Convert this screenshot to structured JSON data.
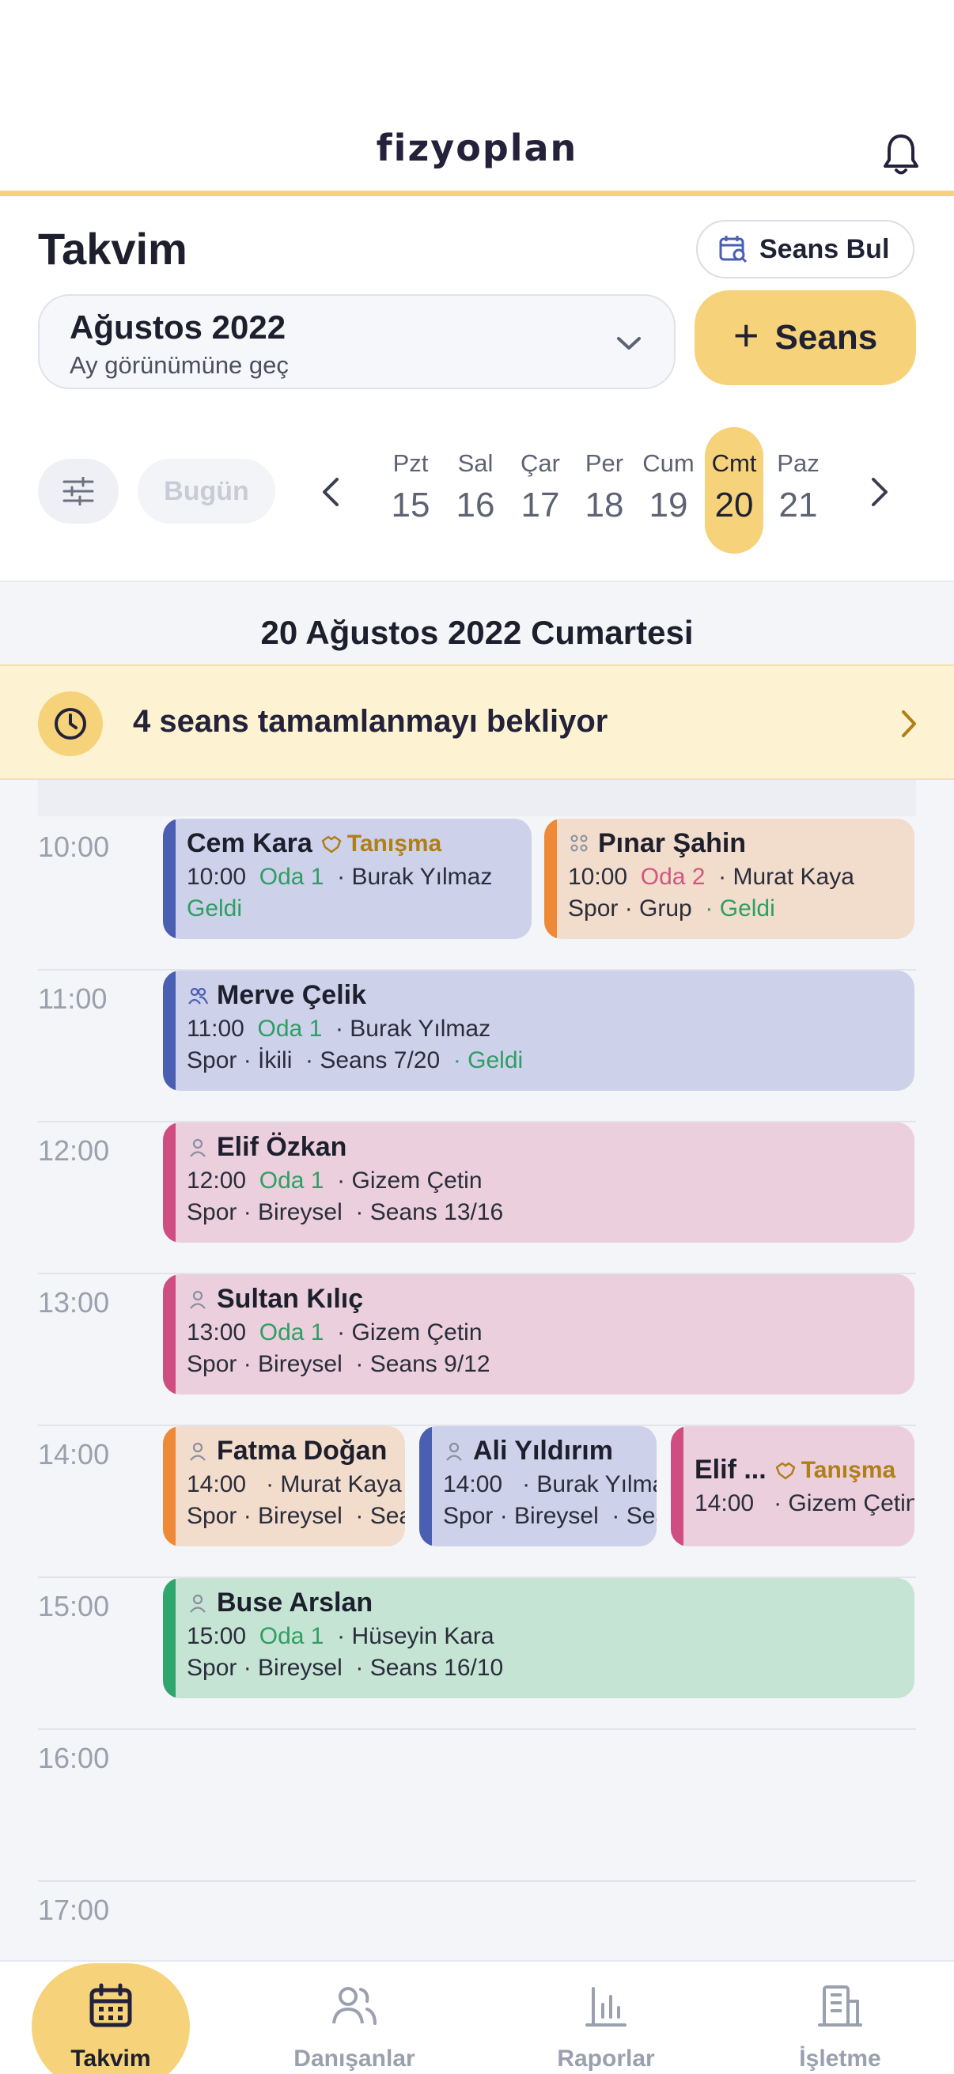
{
  "app": {
    "logo": "fizyoplan"
  },
  "header": {
    "title": "Takvim",
    "find_session_label": "Seans Bul",
    "month": "Ağustos 2022",
    "month_subtitle": "Ay görünümüne geç",
    "add_session_label": "Seans"
  },
  "week": {
    "today_label": "Bugün",
    "days": [
      {
        "name": "Pzt",
        "num": "15"
      },
      {
        "name": "Sal",
        "num": "16"
      },
      {
        "name": "Çar",
        "num": "17"
      },
      {
        "name": "Per",
        "num": "18"
      },
      {
        "name": "Cum",
        "num": "19"
      },
      {
        "name": "Cmt",
        "num": "20",
        "selected": true
      },
      {
        "name": "Paz",
        "num": "21"
      }
    ]
  },
  "day": {
    "heading": "20 Ağustos 2022 Cumartesi",
    "pending_text": "4 seans tamamlanmayı bekliyor",
    "hours": [
      "10:00",
      "11:00",
      "12:00",
      "13:00",
      "14:00",
      "15:00",
      "16:00",
      "17:00"
    ]
  },
  "events": {
    "e1": {
      "name": "Cem Kara",
      "tag": "Tanışma",
      "time": "10:00",
      "room": "Oda 1",
      "therapist": "· Burak Yılmaz",
      "status": "Geldi"
    },
    "e2": {
      "name": "Pınar Şahin",
      "time": "10:00",
      "room": "Oda 2",
      "therapist": "· Murat Kaya",
      "detail": "Spor · Grup",
      "status": "· Geldi"
    },
    "e3": {
      "name": "Merve Çelik",
      "time": "11:00",
      "room": "Oda 1",
      "therapist": "· Burak Yılmaz",
      "detail": "Spor · İkili",
      "sessions": "· Seans 7/20",
      "status": "· Geldi"
    },
    "e4": {
      "name": "Elif Özkan",
      "time": "12:00",
      "room": "Oda 1",
      "therapist": "· Gizem Çetin",
      "detail": "Spor · Bireysel",
      "sessions": "· Seans 13/16"
    },
    "e5": {
      "name": "Sultan Kılıç",
      "time": "13:00",
      "room": "Oda 1",
      "therapist": "· Gizem Çetin",
      "detail": "Spor · Bireysel",
      "sessions": "· Seans 9/12"
    },
    "e6": {
      "name": "Fatma Doğan",
      "time": "14:00",
      "therapist": "· Murat Kaya",
      "detail": "Spor · Bireysel",
      "sessions": "· Seans"
    },
    "e7": {
      "name": "Ali Yıldırım",
      "time": "14:00",
      "therapist": "· Burak Yılmaz",
      "detail": "Spor · Bireysel",
      "sessions": "· Seans"
    },
    "e8": {
      "name": "Elif ...",
      "tag": "Tanışma",
      "time": "14:00",
      "therapist": "· Gizem Çetin"
    },
    "e9": {
      "name": "Buse Arslan",
      "time": "15:00",
      "room": "Oda 1",
      "therapist": "· Hüseyin Kara",
      "detail": "Spor · Bireysel",
      "sessions": "· Seans 16/10"
    }
  },
  "nav": {
    "calendar": "Takvim",
    "clients": "Danışanlar",
    "reports": "Raporlar",
    "business": "İşletme"
  },
  "colors": {
    "accent": "#f6d37a",
    "room_green": "#2f9e63",
    "room_pink": "#d0577f",
    "event_blue": "#cdd1e9",
    "event_orange": "#f2dccb",
    "event_pink": "#ebcfdc",
    "event_green": "#c5e4d4"
  }
}
